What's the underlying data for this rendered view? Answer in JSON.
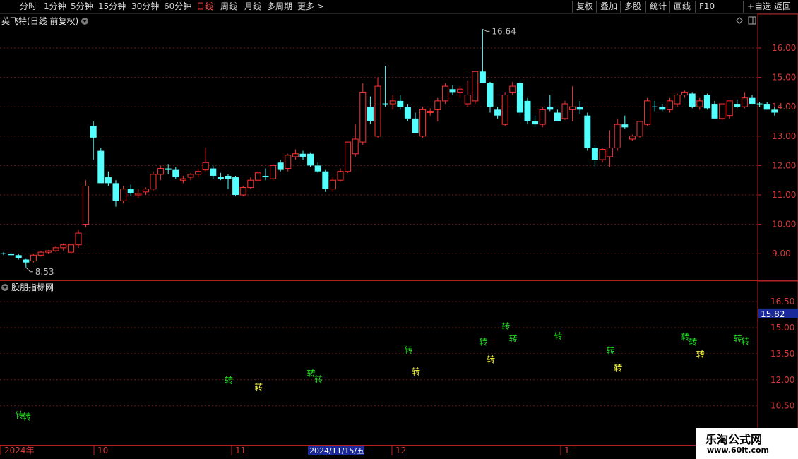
{
  "toolbar": {
    "periods": [
      "分时",
      "1分钟",
      "5分钟",
      "15分钟",
      "30分钟",
      "60分钟",
      "日线",
      "周线",
      "月线",
      "多周期",
      "更多"
    ],
    "active_period": "日线",
    "buttons": [
      "复权",
      "叠加",
      "多股",
      "统计",
      "画线",
      "F10",
      "+自选",
      "返回"
    ]
  },
  "main_panel": {
    "stock_name": "英飞特",
    "title_suffix": "(日线 前复权)",
    "y_ticks": [
      "16.00",
      "15.00",
      "14.00",
      "13.00",
      "12.00",
      "11.00",
      "10.00",
      "9.00"
    ],
    "high_label": "16.64",
    "low_label": "8.53",
    "up_color": "#ff3232",
    "down_color": "#54ffff"
  },
  "sub_panel": {
    "title": "股朋指标网",
    "y_ticks": [
      "16.50",
      "15.00",
      "13.50",
      "12.00",
      "10.50"
    ],
    "current_value": "15.82",
    "signal_char": "转",
    "signal_colors": {
      "green": "#22dd22",
      "yellow": "#ffff44"
    }
  },
  "x_axis": {
    "labels": [
      "2024年",
      "10",
      "11",
      "12",
      "1"
    ],
    "highlight_label": "2024/11/15/五"
  },
  "watermark": {
    "title": "乐淘公式网",
    "url": "www.60lt.com"
  },
  "chart_data": {
    "type": "candlestick",
    "title": "英飞特",
    "ylim": [
      8.0,
      17.0
    ],
    "series": [
      {
        "name": "英飞特",
        "ohlc": [
          [
            9.0,
            9.05,
            8.95,
            9.0
          ],
          [
            9.0,
            9.02,
            8.9,
            8.95
          ],
          [
            8.95,
            9.0,
            8.8,
            8.85
          ],
          [
            8.8,
            8.82,
            8.53,
            8.7
          ],
          [
            8.75,
            9.0,
            8.7,
            8.95
          ],
          [
            8.95,
            9.1,
            8.9,
            9.05
          ],
          [
            9.05,
            9.12,
            9.0,
            9.1
          ],
          [
            9.1,
            9.25,
            9.05,
            9.2
          ],
          [
            9.2,
            9.35,
            9.1,
            9.3
          ],
          [
            9.05,
            9.3,
            9.0,
            9.3
          ],
          [
            9.3,
            9.8,
            9.2,
            9.7
          ],
          [
            10.0,
            11.5,
            9.9,
            11.3
          ],
          [
            13.35,
            13.5,
            12.2,
            12.95
          ],
          [
            12.5,
            12.6,
            11.5,
            11.4
          ],
          [
            11.6,
            11.8,
            11.3,
            11.4
          ],
          [
            11.4,
            11.5,
            10.6,
            10.8
          ],
          [
            10.8,
            11.3,
            10.7,
            11.2
          ],
          [
            11.2,
            11.35,
            10.95,
            11.05
          ],
          [
            11.0,
            11.2,
            10.9,
            11.05
          ],
          [
            11.1,
            11.25,
            11.0,
            11.2
          ],
          [
            11.2,
            11.8,
            11.15,
            11.7
          ],
          [
            11.7,
            12.0,
            11.5,
            11.9
          ],
          [
            11.9,
            12.05,
            11.7,
            11.85
          ],
          [
            11.85,
            11.95,
            11.55,
            11.6
          ],
          [
            11.5,
            11.65,
            11.4,
            11.55
          ],
          [
            11.6,
            11.75,
            11.5,
            11.7
          ],
          [
            11.7,
            11.9,
            11.6,
            11.8
          ],
          [
            11.85,
            12.6,
            11.8,
            12.1
          ],
          [
            11.9,
            12.0,
            11.55,
            11.65
          ],
          [
            11.6,
            11.75,
            11.5,
            11.55
          ],
          [
            11.65,
            11.7,
            11.2,
            11.55
          ],
          [
            11.6,
            11.65,
            10.95,
            11.0
          ],
          [
            11.0,
            11.3,
            10.95,
            11.25
          ],
          [
            11.25,
            11.6,
            11.2,
            11.5
          ],
          [
            11.5,
            11.8,
            11.45,
            11.75
          ],
          [
            11.65,
            11.9,
            11.5,
            11.6
          ],
          [
            11.55,
            12.05,
            11.5,
            12.0
          ],
          [
            12.1,
            12.2,
            11.8,
            11.85
          ],
          [
            11.9,
            12.4,
            11.8,
            12.35
          ],
          [
            12.3,
            12.55,
            12.2,
            12.4
          ],
          [
            12.4,
            12.5,
            12.2,
            12.3
          ],
          [
            12.4,
            12.45,
            11.95,
            12.0
          ],
          [
            12.0,
            12.1,
            11.75,
            11.8
          ],
          [
            11.8,
            11.85,
            11.1,
            11.2
          ],
          [
            11.2,
            11.6,
            11.1,
            11.5
          ],
          [
            11.5,
            11.9,
            11.45,
            11.8
          ],
          [
            11.8,
            12.8,
            11.75,
            12.8
          ],
          [
            12.4,
            13.4,
            12.3,
            12.9
          ],
          [
            12.8,
            14.8,
            12.7,
            14.5
          ],
          [
            14.0,
            14.35,
            13.4,
            13.5
          ],
          [
            13.0,
            15.0,
            12.95,
            14.7
          ],
          [
            14.1,
            15.4,
            14.0,
            14.1
          ],
          [
            14.1,
            14.4,
            13.9,
            14.2
          ],
          [
            14.2,
            14.4,
            13.9,
            14.0
          ],
          [
            14.0,
            14.1,
            13.5,
            13.6
          ],
          [
            13.6,
            13.8,
            13.1,
            13.1
          ],
          [
            13.0,
            14.0,
            12.95,
            13.9
          ],
          [
            13.8,
            13.95,
            13.7,
            13.85
          ],
          [
            13.9,
            14.3,
            13.5,
            14.2
          ],
          [
            14.2,
            14.8,
            14.1,
            14.7
          ],
          [
            14.6,
            14.75,
            14.4,
            14.5
          ],
          [
            14.5,
            14.7,
            14.3,
            14.6
          ],
          [
            14.1,
            14.9,
            14.0,
            14.4
          ],
          [
            14.2,
            15.2,
            14.1,
            15.2
          ],
          [
            15.2,
            16.64,
            14.8,
            14.8
          ],
          [
            14.8,
            14.85,
            13.8,
            14.0
          ],
          [
            13.9,
            14.0,
            13.6,
            13.7
          ],
          [
            13.4,
            14.5,
            13.35,
            14.4
          ],
          [
            14.5,
            14.85,
            14.4,
            14.7
          ],
          [
            14.8,
            14.9,
            13.7,
            13.8
          ],
          [
            14.2,
            14.3,
            13.4,
            13.5
          ],
          [
            13.5,
            13.7,
            13.3,
            13.4
          ],
          [
            13.4,
            14.0,
            13.3,
            13.9
          ],
          [
            14.0,
            14.4,
            13.85,
            13.9
          ],
          [
            13.8,
            13.9,
            13.6,
            13.5
          ],
          [
            13.6,
            14.2,
            13.55,
            14.1
          ],
          [
            13.9,
            14.7,
            13.5,
            14.0
          ],
          [
            14.0,
            14.2,
            13.75,
            13.9
          ],
          [
            13.7,
            13.8,
            12.5,
            12.6
          ],
          [
            12.6,
            12.7,
            11.95,
            12.2
          ],
          [
            12.2,
            12.6,
            12.1,
            12.55
          ],
          [
            12.3,
            13.2,
            11.95,
            12.6
          ],
          [
            12.6,
            13.6,
            12.5,
            13.4
          ],
          [
            13.4,
            13.7,
            13.25,
            13.3
          ],
          [
            12.9,
            13.05,
            12.85,
            13.0
          ],
          [
            13.0,
            13.5,
            12.95,
            13.5
          ],
          [
            13.4,
            14.3,
            13.35,
            14.2
          ],
          [
            14.0,
            14.2,
            13.85,
            14.0
          ],
          [
            14.0,
            14.1,
            13.85,
            13.9
          ],
          [
            13.9,
            14.3,
            13.8,
            14.2
          ],
          [
            14.1,
            14.45,
            14.0,
            14.4
          ],
          [
            14.4,
            14.55,
            14.3,
            14.5
          ],
          [
            14.45,
            14.5,
            13.95,
            14.0
          ],
          [
            14.0,
            14.3,
            13.9,
            14.2
          ],
          [
            14.4,
            14.45,
            13.9,
            13.95
          ],
          [
            14.1,
            14.2,
            13.6,
            13.6
          ],
          [
            13.6,
            14.1,
            13.55,
            14.1
          ],
          [
            13.7,
            14.2,
            13.6,
            14.2
          ],
          [
            14.1,
            14.25,
            13.95,
            14.0
          ],
          [
            14.0,
            14.5,
            13.95,
            14.3
          ],
          [
            14.3,
            14.4,
            14.1,
            14.1
          ],
          [
            14.1,
            14.15,
            14.0,
            14.1
          ],
          [
            14.1,
            14.15,
            13.9,
            13.9
          ],
          [
            13.9,
            14.0,
            13.7,
            13.8
          ]
        ]
      }
    ],
    "signals": [
      {
        "index": 2,
        "value": 10.0,
        "color": "green"
      },
      {
        "index": 3,
        "value": 9.9,
        "color": "green"
      },
      {
        "index": 30,
        "value": 12.0,
        "color": "green"
      },
      {
        "index": 34,
        "value": 11.6,
        "color": "yellow"
      },
      {
        "index": 41,
        "value": 12.4,
        "color": "green"
      },
      {
        "index": 42,
        "value": 12.05,
        "color": "green"
      },
      {
        "index": 54,
        "value": 13.75,
        "color": "green"
      },
      {
        "index": 55,
        "value": 12.5,
        "color": "yellow"
      },
      {
        "index": 64,
        "value": 14.2,
        "color": "green"
      },
      {
        "index": 65,
        "value": 13.2,
        "color": "yellow"
      },
      {
        "index": 67,
        "value": 15.1,
        "color": "green"
      },
      {
        "index": 68,
        "value": 14.4,
        "color": "green"
      },
      {
        "index": 74,
        "value": 14.55,
        "color": "green"
      },
      {
        "index": 81,
        "value": 13.7,
        "color": "green"
      },
      {
        "index": 82,
        "value": 12.7,
        "color": "yellow"
      },
      {
        "index": 91,
        "value": 14.5,
        "color": "green"
      },
      {
        "index": 92,
        "value": 14.2,
        "color": "green"
      },
      {
        "index": 93,
        "value": 13.5,
        "color": "yellow"
      },
      {
        "index": 98,
        "value": 14.4,
        "color": "green"
      },
      {
        "index": 99,
        "value": 14.25,
        "color": "green"
      }
    ]
  }
}
